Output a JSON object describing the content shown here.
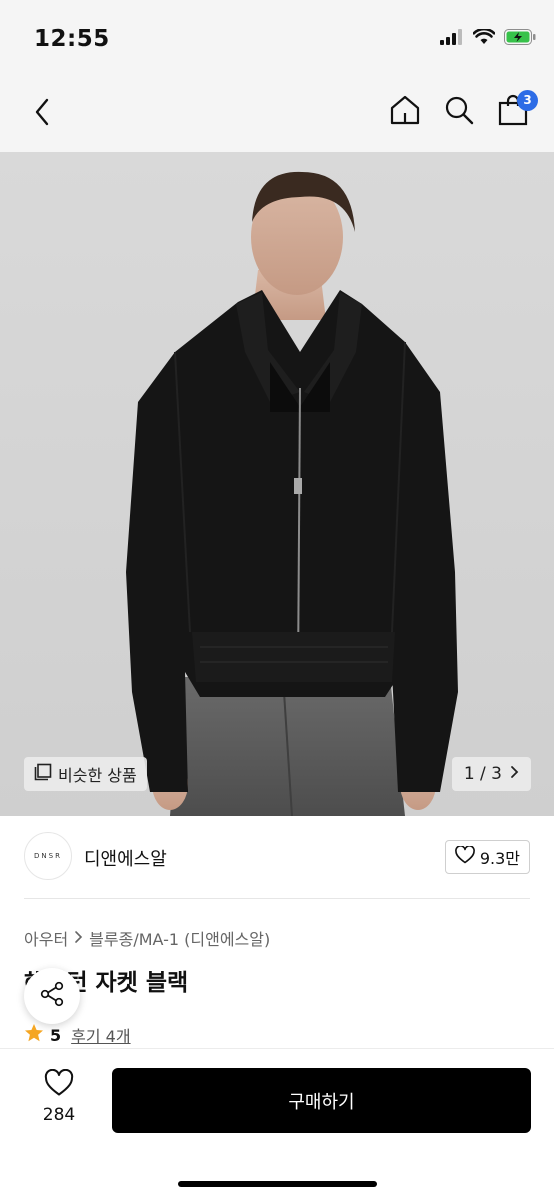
{
  "status": {
    "time": "12:55"
  },
  "nav": {
    "cart_count": "3"
  },
  "hero": {
    "similar_label": "비슷한 상품",
    "counter": "1 / 3"
  },
  "brand": {
    "logo_text": "DNSR",
    "name": "디앤에스알",
    "likes": "9.3만"
  },
  "product": {
    "breadcrumb": [
      "아우터",
      "블루종/MA-1 (디앤에스알)"
    ],
    "title": "해링턴 자켓 블랙",
    "rating": "5",
    "reviews_label": "후기 4개"
  },
  "bottom": {
    "wish_count": "284",
    "buy_label": "구매하기"
  },
  "colors": {
    "accent_badge": "#2d6ce6",
    "rating_star": "#f5a623",
    "buy_button": "#000000"
  },
  "icons": [
    "back-icon",
    "home-icon",
    "search-icon",
    "bag-icon",
    "similar-icon",
    "chevron-right-icon",
    "heart-icon",
    "share-icon",
    "star-icon",
    "signal-icon",
    "wifi-icon",
    "battery-icon"
  ]
}
